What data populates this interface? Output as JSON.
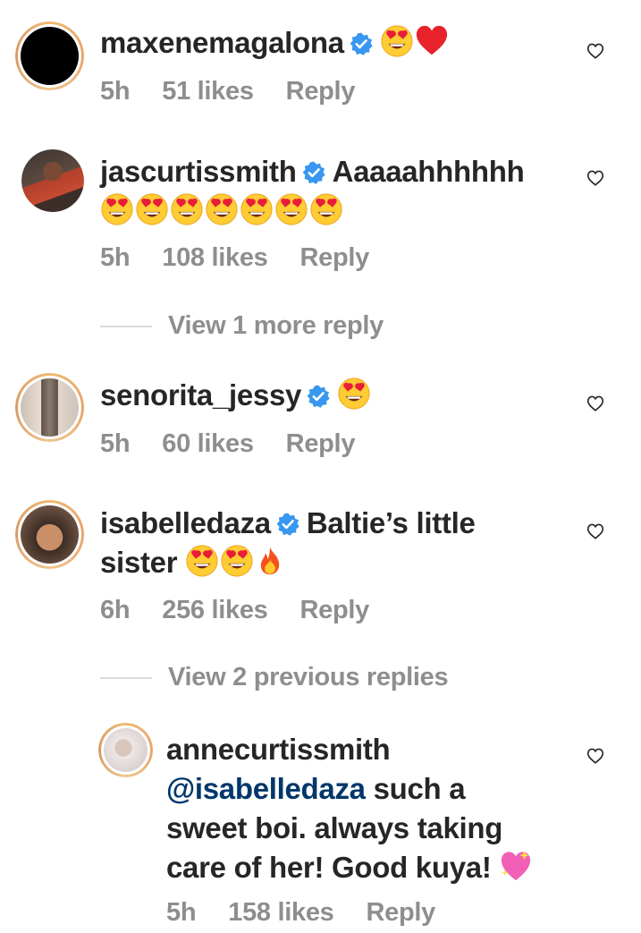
{
  "comments": [
    {
      "username": "maxenemagalona",
      "verified": true,
      "text": "",
      "emojis": [
        "heart-eyes-emoji",
        "red-heart-emoji"
      ],
      "time": "5h",
      "likes": "51 likes",
      "reply": "Reply"
    },
    {
      "username": "jascurtissmith",
      "verified": true,
      "text": "Aaaaahhhhhh",
      "emojis": [
        "heart-eyes-emoji",
        "heart-eyes-emoji",
        "heart-eyes-emoji",
        "heart-eyes-emoji",
        "heart-eyes-emoji",
        "heart-eyes-emoji",
        "heart-eyes-emoji"
      ],
      "time": "5h",
      "likes": "108 likes",
      "reply": "Reply",
      "view_more": "View 1 more reply"
    },
    {
      "username": "senorita_jessy",
      "verified": true,
      "text": "",
      "emojis": [
        "heart-eyes-emoji"
      ],
      "time": "5h",
      "likes": "60 likes",
      "reply": "Reply"
    },
    {
      "username": "isabelledaza",
      "verified": true,
      "text_line1": "Baltie’s little",
      "text_line2": "sister",
      "emojis": [
        "heart-eyes-emoji",
        "heart-eyes-emoji",
        "fire-emoji"
      ],
      "time": "6h",
      "likes": "256 likes",
      "reply": "Reply",
      "view_more": "View 2 previous replies"
    }
  ],
  "reply": {
    "username": "annecurtissmith",
    "mention": "@isabelledaza",
    "text_line1": " such a",
    "text_line2": "sweet boi. always taking",
    "text_line3": "care of her! Good kuya!",
    "emojis": [
      "sparkling-heart-emoji"
    ],
    "time": "5h",
    "likes": "158 likes",
    "reply": "Reply"
  },
  "colors": {
    "text": "#262626",
    "meta": "#8e8e8e",
    "mention": "#00376b",
    "verified": "#3897f0",
    "story_ring": "#f0b873"
  }
}
